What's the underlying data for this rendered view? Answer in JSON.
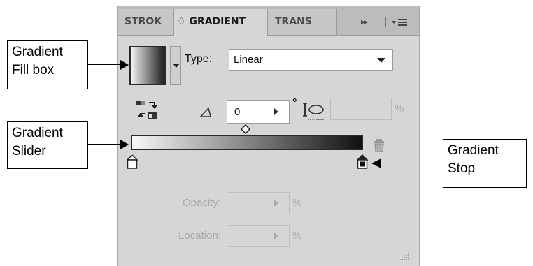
{
  "tabs": [
    {
      "label": "STROK",
      "active": false
    },
    {
      "label": "♢ GRADIENT",
      "active": true
    },
    {
      "label": "TRANS",
      "active": false
    }
  ],
  "tab_menu": {
    "collapse_glyph": "▸▸"
  },
  "fill": {
    "type_label": "Type:",
    "type_value": "Linear",
    "gradient_colors": [
      "#f4f4f4",
      "#1e1e1e"
    ]
  },
  "angle": {
    "value": "0",
    "unit": "°"
  },
  "aspect": {
    "unit": "%"
  },
  "opacity": {
    "label": "Opacity:",
    "unit": "%"
  },
  "location": {
    "label": "Location:",
    "unit": "%"
  },
  "callouts": {
    "fill_box": "Gradient\nFill box",
    "slider": "Gradient\nSlider",
    "stop": "Gradient\nStop"
  },
  "colors": {
    "panel_bg": "#d6d6d6",
    "tabbar_bg": "#bcbcbc",
    "stop_left": "#ffffff",
    "stop_right": "#111111"
  }
}
